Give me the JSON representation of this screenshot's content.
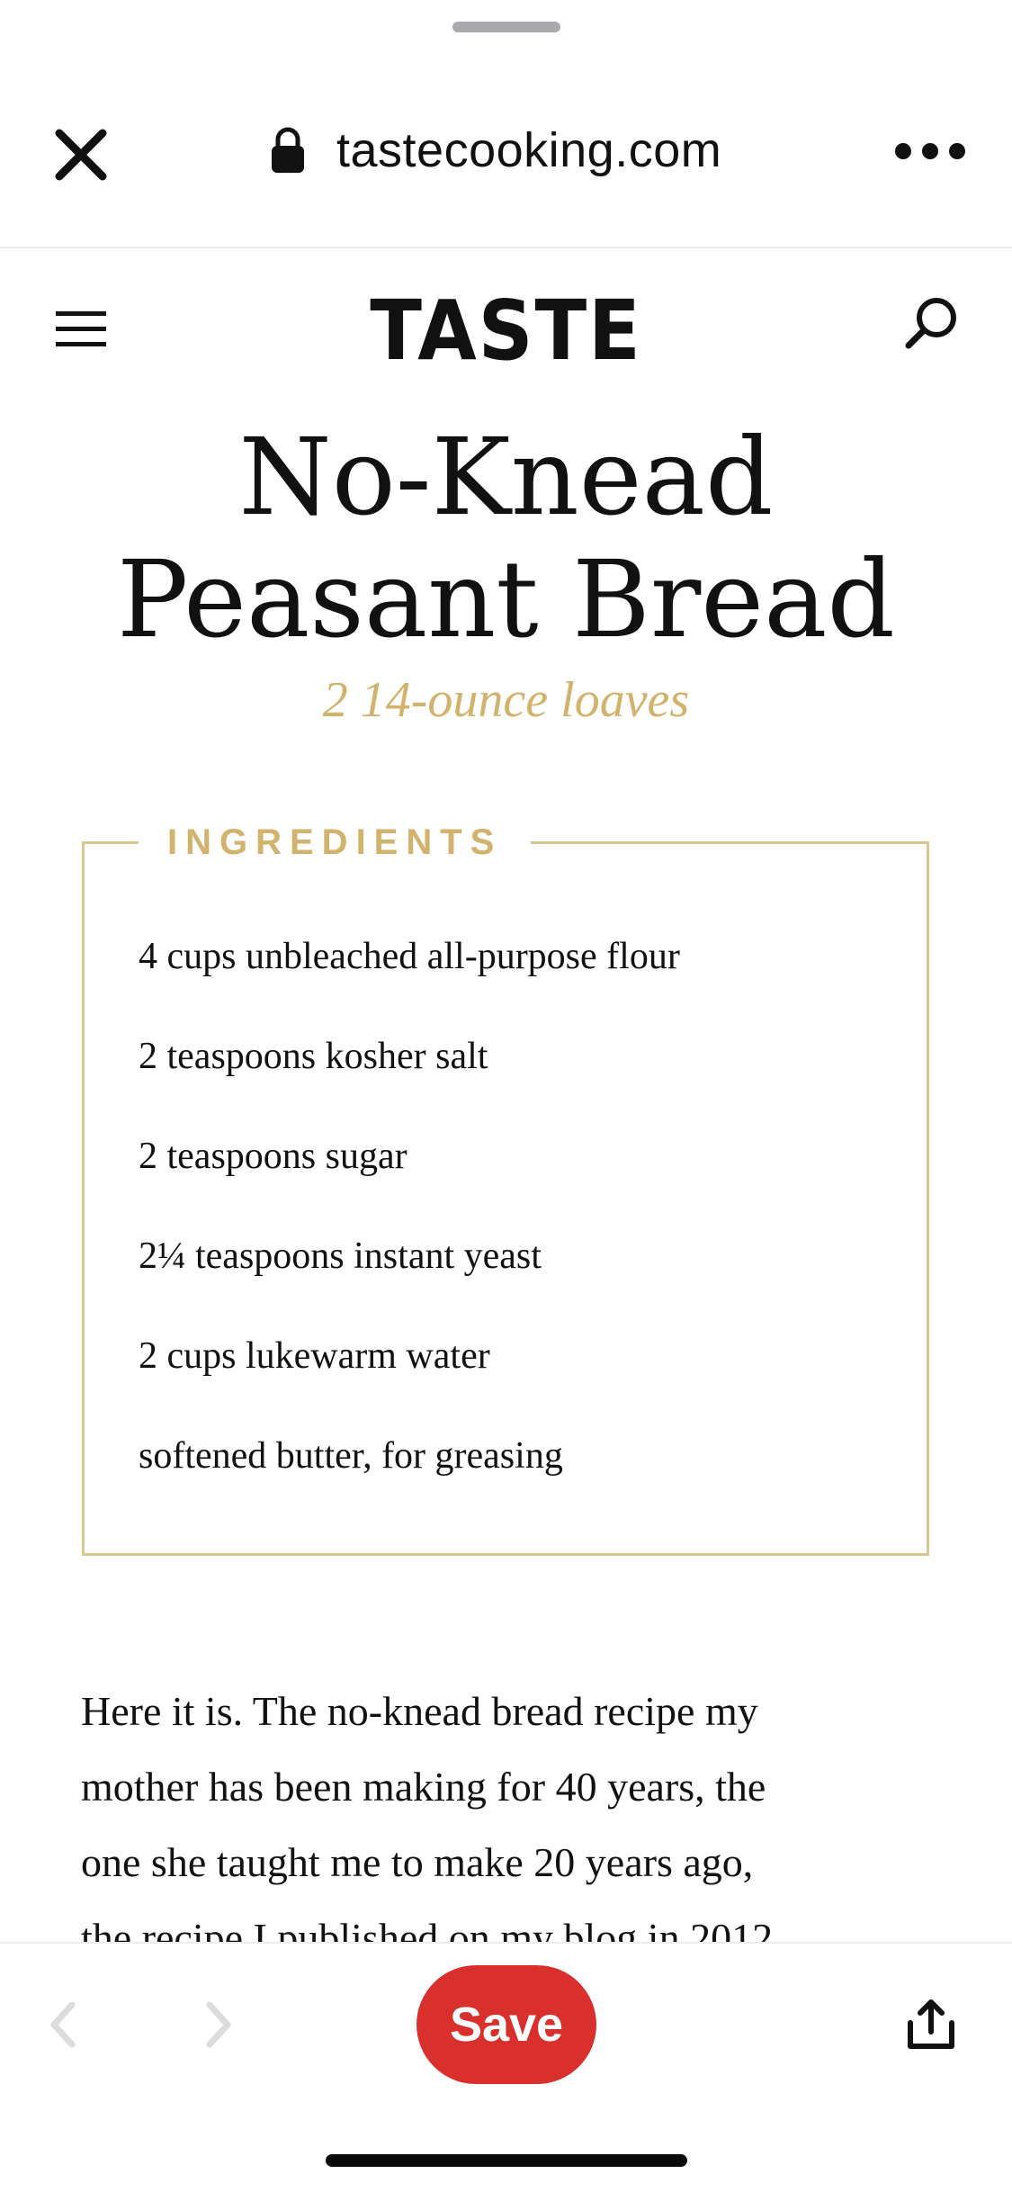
{
  "browser": {
    "url": "tastecooking.com",
    "icons": [
      "close-icon",
      "lock-icon",
      "more-icon"
    ]
  },
  "site": {
    "logo": "TASTE",
    "icons": [
      "menu-icon",
      "search-icon"
    ]
  },
  "recipe": {
    "title_line1": "No-Knead",
    "title_line2": "Peasant Bread",
    "yield": "2 14-ounce loaves",
    "ingredients_label": "INGREDIENTS",
    "ingredients": [
      "4 cups unbleached all-purpose flour",
      "2 teaspoons kosher salt",
      "2 teaspoons sugar",
      "2¼ teaspoons instant yeast",
      "2 cups lukewarm water",
      "softened butter, for greasing"
    ],
    "intro_lines": [
      "Here it is. The no-knead bread recipe my",
      "mother has been making for 40 years, the",
      "one she taught me to make 20 years ago,",
      "the recipe I published on my blog in 2012"
    ]
  },
  "toolbar": {
    "save_label": "Save",
    "accent_color": "#d9302d",
    "icons": [
      "back-icon",
      "forward-icon",
      "share-icon"
    ]
  },
  "colors": {
    "gold": "#d2b36e",
    "box_border": "#d8c58f"
  }
}
